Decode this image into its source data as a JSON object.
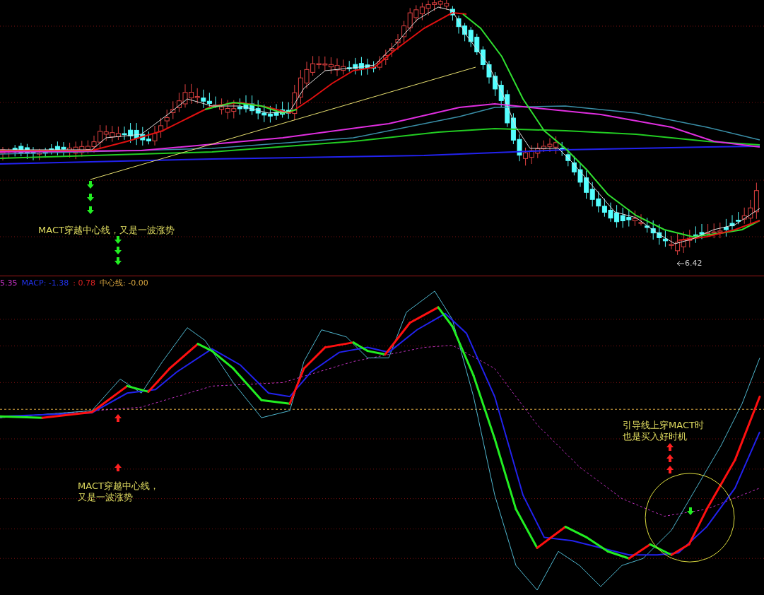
{
  "price_panel": {
    "low_label": "6.42",
    "annotations": [
      {
        "text": "MACT穿越中心线，又是一波涨势",
        "kind": "text"
      }
    ]
  },
  "indicator_legend": [
    {
      "text": "5.35",
      "color": "#cc33cc"
    },
    {
      "text": "MACP: -1.38",
      "color": "#2233ee"
    },
    {
      "text": ": 0.78",
      "color": "#dd2222"
    },
    {
      "text": "中心线: -0.00",
      "color": "#d9a640"
    }
  ],
  "indicator_panel": {
    "annotations": [
      {
        "lines": [
          "MACT穿越中心线，",
          "又是一波涨势"
        ],
        "kind": "text"
      },
      {
        "lines": [
          "引导线上穿MACT时",
          "也是买入好时机"
        ],
        "kind": "text"
      }
    ]
  }
}
